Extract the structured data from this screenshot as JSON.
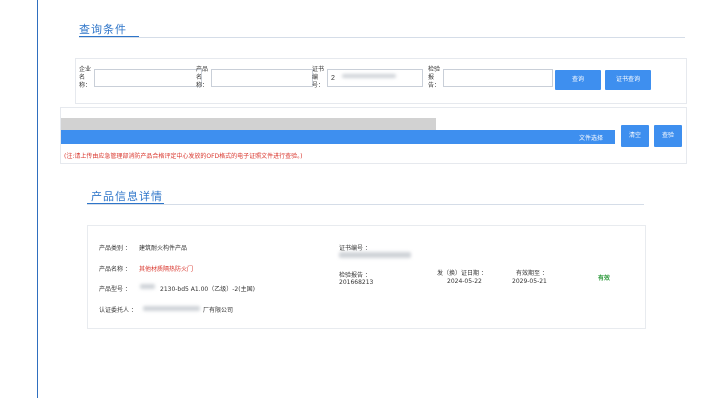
{
  "query_section": {
    "title": "查询条件",
    "fields": [
      {
        "label": "企业名称：",
        "value": "",
        "placeholder": ""
      },
      {
        "label": "产品名称：",
        "value": "",
        "placeholder": ""
      },
      {
        "label": "证书编号：",
        "value": "2",
        "placeholder": ""
      },
      {
        "label": "检验报告：",
        "value": "",
        "placeholder": ""
      }
    ],
    "search_button": "查询",
    "cert_search_button": "证书查询"
  },
  "upload": {
    "choose_file_label": "文件选择",
    "clear_button": "清空",
    "verify_button": "查验",
    "notice": "(注:请上传由应急管理部消防产品合格评定中心发放的OFD格式的电子证照文件进行查验。)"
  },
  "detail_section": {
    "title": "产品信息详情",
    "category_label": "产品类别 ：",
    "category_value": "建筑耐火构件产品",
    "name_label": "产品名称 ：",
    "name_value": "其他材质隔热防火门",
    "model_label": "产品型号 ：",
    "model_value": "2130-bd5 A1.00（乙级）-2(主国)",
    "client_label": "认证委托人 ：",
    "client_value": "厂有限公司",
    "cert_no_label": "证书编号 ：",
    "report_label": "检验报告 ：",
    "report_value": "201668213",
    "issue_date_label": "发（换）证日期 ：",
    "issue_date_value": "2024-05-22",
    "expiry_label": "有效期至 ：",
    "expiry_value": "2029-05-21",
    "status": "有效"
  },
  "colors": {
    "accent": "#3e8fef",
    "title_blue": "#2e75c9",
    "warning_red": "#d9342b",
    "valid_green": "#2e9a3c"
  }
}
